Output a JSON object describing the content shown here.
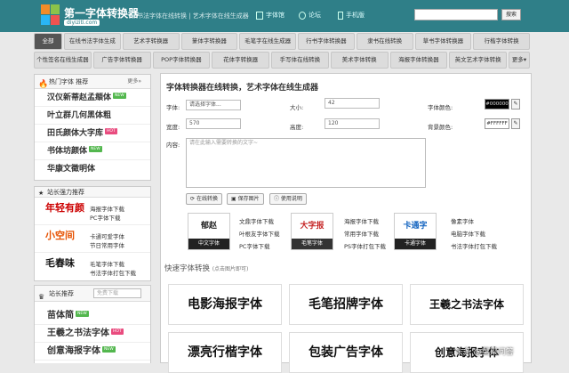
{
  "header": {
    "logo_title": "第一字体转换器",
    "logo_url": "diyiziti.com",
    "slogan": "书法字体在线转换 | 艺术字体在线生成器",
    "nav": [
      "字体馆",
      "论坛",
      "手机版"
    ],
    "search_button": "搜索",
    "search_placeholder": ""
  },
  "nav_row1": [
    "全部",
    "在线书法字体生成",
    "艺术字转换器",
    "篆体字转换器",
    "毛笔字在线生成器",
    "行书字体转换器",
    "隶书在线转换",
    "草书字体转换器",
    "行楷字体转换"
  ],
  "nav_row2": [
    "个性签名在线生成器",
    "广告字体转换器",
    "POP字体转换器",
    "花体字转换器",
    "手写体在线转换",
    "美术字体转换",
    "海报字体转换器",
    "英文艺术字体转换",
    "更多▾"
  ],
  "hot_fonts": {
    "title": "热门字体 推荐",
    "more": "更多»",
    "items": [
      {
        "name": "汉仪新蒂赵孟頫体",
        "badge": "NEW"
      },
      {
        "name": "叶立群几何黑体粗",
        "badge": ""
      },
      {
        "name": "田氏颜体大字库",
        "badge": "HOT"
      },
      {
        "name": "书体坊颜体",
        "badge": "NEW"
      },
      {
        "name": "华康文徵明体",
        "badge": ""
      }
    ]
  },
  "strong_rec": {
    "title": "站长强力推荐",
    "items": [
      {
        "art": "年轻有颜",
        "l1": "海报字体下载",
        "l2": "PC字体下载"
      },
      {
        "art": "小空间",
        "l1": "卡通可爱字体",
        "l2": "节日常用字体"
      },
      {
        "art": "毛春味",
        "l1": "毛笔字体下载",
        "l2": "书法字体打包下载"
      }
    ]
  },
  "webmaster_rec": {
    "title": "站长推荐",
    "search_placeholder": "免费下载",
    "items": [
      {
        "name": "苗体简",
        "badge": "NEW"
      },
      {
        "name": "王羲之书法字体",
        "badge": "HOT"
      },
      {
        "name": "创意海报字体",
        "badge": "NEW"
      }
    ]
  },
  "main": {
    "title": "字体转换器在线转换，艺术字体在线生成器",
    "font_label": "字体:",
    "font_value": "请选择字体...",
    "size_label": "大小:",
    "size_value": "42",
    "color_label": "字体颜色:",
    "color_value": "#000000",
    "width_label": "宽度:",
    "width_value": "570",
    "height_label": "高度:",
    "height_value": "120",
    "bg_label": "背景颜色:",
    "bg_value": "#FFFFFF",
    "content_label": "内容:",
    "content_placeholder": "请在此输入需要转换的文字~",
    "btn_convert": "在线转换",
    "btn_save": "保存图片",
    "btn_help": "使用说明",
    "cards": [
      {
        "art": "郁赵",
        "cap": "中文字体",
        "color": "#222"
      },
      {
        "art": "大字报",
        "cap": "毛笔字体",
        "color": "#c62828"
      },
      {
        "art": "卡通字",
        "cap": "卡通字体",
        "color": "#1565c0"
      }
    ],
    "card_links": [
      [
        "文鼎字体下载",
        "叶根友字体下载",
        "PC字体下载"
      ],
      [
        "海报字体下载",
        "常用字体下载",
        "PS字体打包下载"
      ],
      [
        "像素字体",
        "电脑字体下载",
        "书法字体打包下载"
      ]
    ],
    "quick_title": "快速字体转换",
    "quick_hint": "(点击图片即可)",
    "tiles": [
      "电影海报字体",
      "毛笔招牌字体",
      "王羲之书法字体",
      "漂亮行楷字体",
      "包装广告字体",
      "创意海报字体"
    ]
  },
  "watermark": "头条 @莫梁问答"
}
